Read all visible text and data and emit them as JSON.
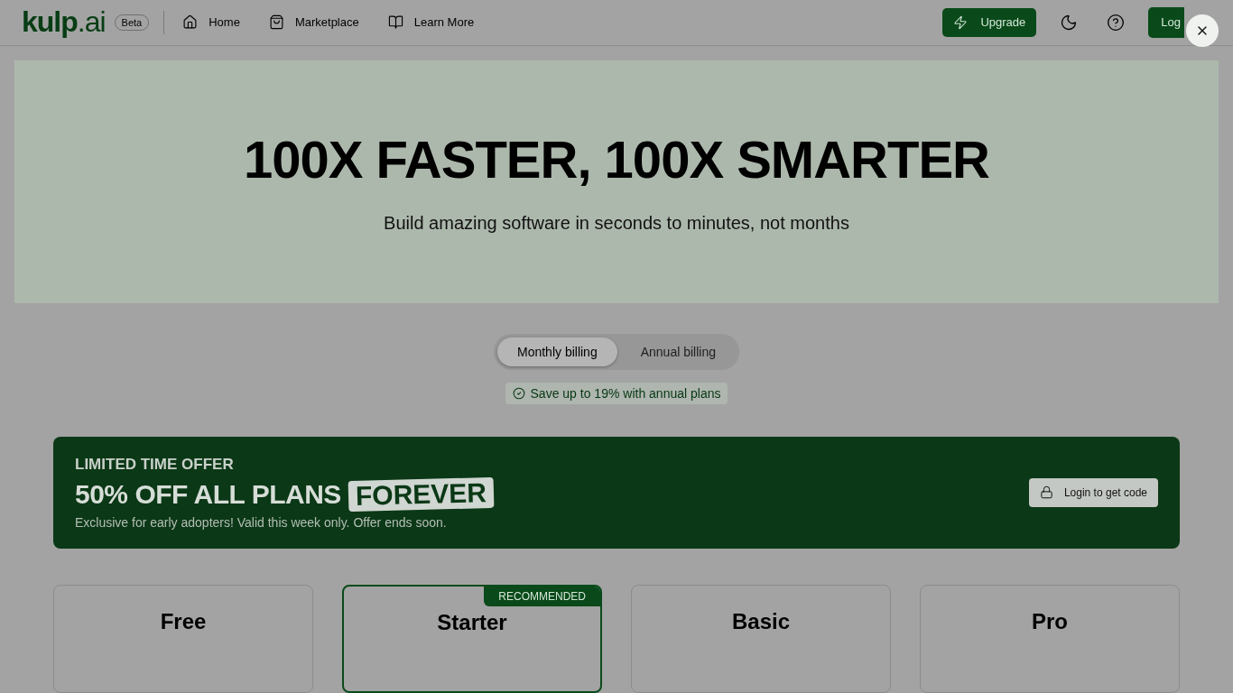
{
  "header": {
    "logo": {
      "name": "kulp",
      "suffix": ".ai"
    },
    "badge": "Beta",
    "nav": [
      {
        "label": "Home"
      },
      {
        "label": "Marketplace"
      },
      {
        "label": "Learn More"
      }
    ],
    "upgrade": "Upgrade",
    "login": "Log"
  },
  "hero": {
    "title": "100X FASTER, 100X SMARTER",
    "subtitle": "Build amazing software in seconds to minutes, not months"
  },
  "billing": {
    "tabs": [
      {
        "label": "Monthly billing",
        "selected": true
      },
      {
        "label": "Annual billing",
        "selected": false
      }
    ],
    "note": "Save up to 19% with annual plans"
  },
  "offer": {
    "eyebrow": "LIMITED TIME OFFER",
    "headline": "50% OFF ALL PLANS",
    "highlight": "FOREVER",
    "text": "Exclusive for early adopters! Valid this week only. Offer ends soon.",
    "button": "Login to get code"
  },
  "plans": [
    {
      "name": "Free",
      "recommended": false
    },
    {
      "name": "Starter",
      "recommended": true,
      "ribbon": "RECOMMENDED"
    },
    {
      "name": "Basic",
      "recommended": false
    },
    {
      "name": "Pro",
      "recommended": false
    }
  ]
}
